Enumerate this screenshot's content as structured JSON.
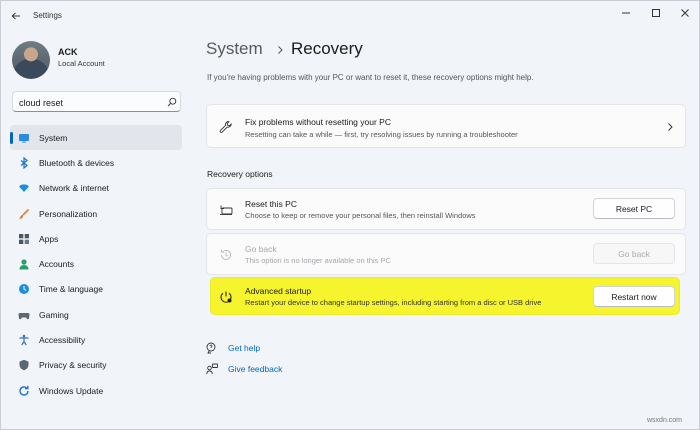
{
  "titlebar": {
    "app_title": "Settings"
  },
  "user": {
    "name": "ACK",
    "account_type": "Local Account"
  },
  "search": {
    "value": "cloud reset",
    "placeholder": "Find a setting"
  },
  "sidebar": {
    "items": [
      {
        "label": "System",
        "icon": "system-icon",
        "active": true
      },
      {
        "label": "Bluetooth & devices",
        "icon": "bluetooth-icon"
      },
      {
        "label": "Network & internet",
        "icon": "wifi-icon"
      },
      {
        "label": "Personalization",
        "icon": "brush-icon"
      },
      {
        "label": "Apps",
        "icon": "apps-icon"
      },
      {
        "label": "Accounts",
        "icon": "person-icon"
      },
      {
        "label": "Time & language",
        "icon": "globe-clock-icon"
      },
      {
        "label": "Gaming",
        "icon": "gamepad-icon"
      },
      {
        "label": "Accessibility",
        "icon": "accessibility-icon"
      },
      {
        "label": "Privacy & security",
        "icon": "shield-icon"
      },
      {
        "label": "Windows Update",
        "icon": "refresh-icon"
      }
    ]
  },
  "header": {
    "parent": "System",
    "current": "Recovery"
  },
  "intro": "If you're having problems with your PC or want to reset it, these recovery options might help.",
  "fix_card": {
    "title": "Fix problems without resetting your PC",
    "desc": "Resetting can take a while — first, try resolving issues by running a troubleshooter"
  },
  "section_title": "Recovery options",
  "options": {
    "reset": {
      "title": "Reset this PC",
      "desc": "Choose to keep or remove your personal files, then reinstall Windows",
      "button": "Reset PC"
    },
    "goback": {
      "title": "Go back",
      "desc": "This option is no longer available on this PC",
      "button": "Go back"
    },
    "advanced": {
      "title": "Advanced startup",
      "desc": "Restart your device to change startup settings, including starting from a disc or USB drive",
      "button": "Restart now"
    }
  },
  "links": {
    "help": "Get help",
    "feedback": "Give feedback"
  },
  "watermark": "wsxdn.com",
  "colors": {
    "accent": "#0067c0",
    "highlight": "#f6f42c",
    "background": "#f1f4f9"
  }
}
